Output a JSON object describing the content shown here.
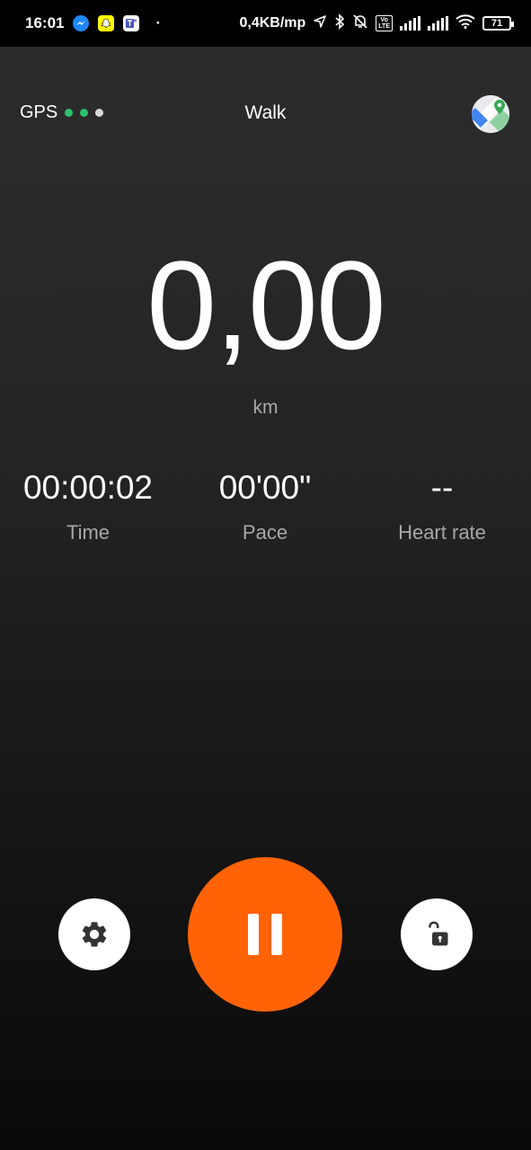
{
  "status_bar": {
    "time": "16:01",
    "dot": "·",
    "net_speed": "0,4KB/mp",
    "battery": "71",
    "icons": [
      "messenger-icon",
      "snapchat-icon",
      "teams-icon",
      "location-arrow-icon",
      "bluetooth-icon",
      "bell-off-icon",
      "volte-icon",
      "signal-icon",
      "signal-icon",
      "wifi-icon",
      "battery-icon"
    ]
  },
  "header": {
    "gps_label": "GPS",
    "gps_dots": [
      "#29c16b",
      "#29c16b",
      "#d9d9d9"
    ],
    "title": "Walk",
    "map_icon": "map-pin-icon"
  },
  "distance": {
    "value": "0,00",
    "unit": "km"
  },
  "stats": [
    {
      "value": "00:00:02",
      "label": "Time"
    },
    {
      "value": "00'00\"",
      "label": "Pace"
    },
    {
      "value": "--",
      "label": "Heart rate"
    }
  ],
  "controls": {
    "settings_icon": "gear-icon",
    "pause_icon": "pause-icon",
    "lock_icon": "unlock-icon",
    "accent": "#ff6306"
  }
}
